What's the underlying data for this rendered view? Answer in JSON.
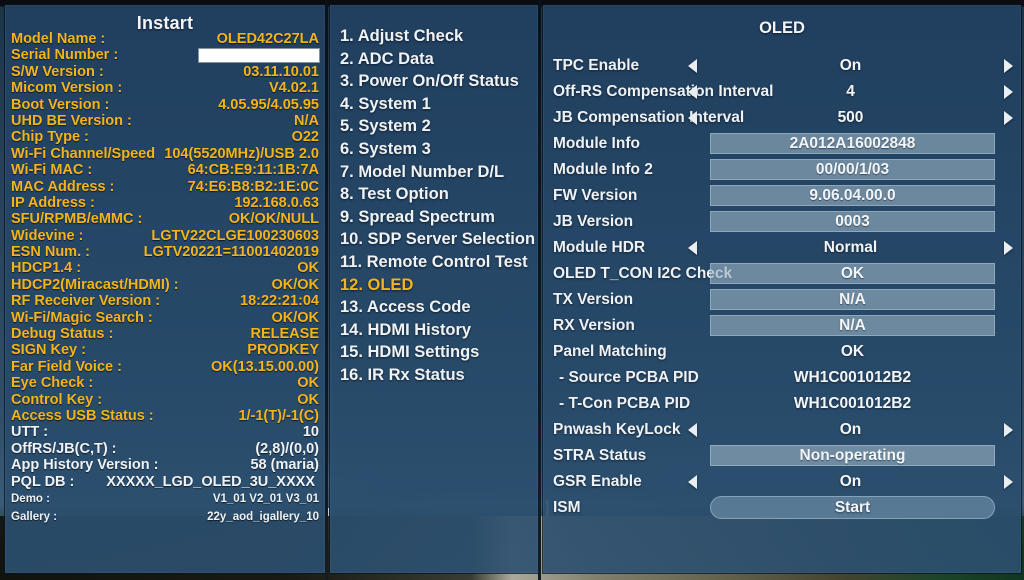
{
  "left_panel": {
    "title": "Instart",
    "rows": [
      {
        "key": "Model Name :",
        "value": "OLED42C27LA",
        "style": "yellow"
      },
      {
        "key": "Serial Number :",
        "value": "",
        "style": "yellow",
        "redacted": true
      },
      {
        "key": "S/W Version :",
        "value": "03.11.10.01",
        "style": "yellow"
      },
      {
        "key": "Micom Version :",
        "value": "V4.02.1",
        "style": "yellow"
      },
      {
        "key": "Boot Version :",
        "value": "4.05.95/4.05.95",
        "style": "yellow"
      },
      {
        "key": "UHD BE Version :",
        "value": "N/A",
        "style": "yellow"
      },
      {
        "key": "Chip Type :",
        "value": "O22",
        "style": "yellow"
      },
      {
        "key": "Wi-Fi Channel/Speed",
        "value": "104(5520MHz)/USB 2.0",
        "style": "yellow"
      },
      {
        "key": "Wi-Fi MAC :",
        "value": "64:CB:E9:11:1B:7A",
        "style": "yellow"
      },
      {
        "key": "MAC Address :",
        "value": "74:E6:B8:B2:1E:0C",
        "style": "yellow"
      },
      {
        "key": "IP Address :",
        "value": "192.168.0.63",
        "style": "yellow"
      },
      {
        "key": "SFU/RPMB/eMMC :",
        "value": "OK/OK/NULL",
        "style": "yellow"
      },
      {
        "key": "Widevine :",
        "value": "LGTV22CLGE100230603",
        "style": "yellow"
      },
      {
        "key": "ESN Num. :",
        "value": "LGTV20221=11001402019",
        "style": "yellow"
      },
      {
        "key": "HDCP1.4 :",
        "value": "OK",
        "style": "yellow"
      },
      {
        "key": "HDCP2(Miracast/HDMI) :",
        "value": "OK/OK",
        "style": "yellow"
      },
      {
        "key": "RF Receiver Version :",
        "value": "18:22:21:04",
        "style": "yellow"
      },
      {
        "key": "Wi-Fi/Magic Search :",
        "value": "OK/OK",
        "style": "yellow"
      },
      {
        "key": "Debug Status :",
        "value": "RELEASE",
        "style": "yellow"
      },
      {
        "key": "SIGN Key :",
        "value": "PRODKEY",
        "style": "yellow"
      },
      {
        "key": "Far Field Voice :",
        "value": "OK(13.15.00.00)",
        "style": "yellow"
      },
      {
        "key": "Eye Check :",
        "value": "OK",
        "style": "yellow"
      },
      {
        "key": "Control Key :",
        "value": "OK",
        "style": "yellow"
      },
      {
        "key": "Access USB Status :",
        "value": "1/-1(T)/-1(C)",
        "style": "yellow"
      },
      {
        "key": "UTT :",
        "value": "10",
        "style": "white"
      },
      {
        "key": "OffRS/JB(C,T) :",
        "value": "(2,8)/(0,0)",
        "style": "white"
      },
      {
        "key": "App History Version :",
        "value": "58 (maria)",
        "style": "white"
      },
      {
        "key": "PQL DB :",
        "value": "XXXXX_LGD_OLED_3U_XXXX",
        "style": "white"
      },
      {
        "key": "Demo :",
        "value": "V1_01 V2_01 V3_01",
        "style": "white",
        "small": true
      },
      {
        "key": "Gallery :",
        "value": "22y_aod_igallery_10",
        "style": "white",
        "small": true
      }
    ]
  },
  "menu_panel": {
    "items": [
      {
        "label": "1. Adjust Check",
        "selected": false
      },
      {
        "label": "2. ADC Data",
        "selected": false
      },
      {
        "label": "3. Power On/Off Status",
        "selected": false
      },
      {
        "label": "4. System 1",
        "selected": false
      },
      {
        "label": "5. System 2",
        "selected": false
      },
      {
        "label": "6. System 3",
        "selected": false
      },
      {
        "label": "7. Model Number D/L",
        "selected": false
      },
      {
        "label": "8. Test Option",
        "selected": false
      },
      {
        "label": "9. Spread Spectrum",
        "selected": false
      },
      {
        "label": "10. SDP Server Selection",
        "selected": false
      },
      {
        "label": "11. Remote Control Test",
        "selected": false
      },
      {
        "label": "12. OLED",
        "selected": true
      },
      {
        "label": "13. Access Code",
        "selected": false
      },
      {
        "label": "14. HDMI History",
        "selected": false
      },
      {
        "label": "15. HDMI Settings",
        "selected": false
      },
      {
        "label": "16. IR Rx Status",
        "selected": false
      }
    ]
  },
  "oled_panel": {
    "title": "OLED",
    "rows": [
      {
        "label": "TPC Enable",
        "value": "On",
        "control": "spinner"
      },
      {
        "label": "Off-RS Compensation Interval",
        "value": "4",
        "control": "spinner"
      },
      {
        "label": "JB Compensation Interval",
        "value": "500",
        "control": "spinner"
      },
      {
        "label": "Module Info",
        "value": "2A012A16002848",
        "control": "boxed"
      },
      {
        "label": "Module Info 2",
        "value": "00/00/1/03",
        "control": "boxed"
      },
      {
        "label": "FW Version",
        "value": "9.06.04.00.0",
        "control": "boxed"
      },
      {
        "label": "JB Version",
        "value": "0003",
        "control": "boxed"
      },
      {
        "label": "Module HDR",
        "value": "Normal",
        "control": "spinner"
      },
      {
        "label": "OLED T_CON I2C Check",
        "value": "OK",
        "control": "boxed"
      },
      {
        "label": "TX Version",
        "value": "N/A",
        "control": "boxed"
      },
      {
        "label": "RX Version",
        "value": "N/A",
        "control": "boxed"
      },
      {
        "label": "Panel Matching",
        "value": "OK",
        "control": "plain"
      },
      {
        "label": " - Source PCBA PID",
        "value": "WH1C001012B2",
        "control": "plain",
        "sub": true
      },
      {
        "label": " - T-Con PCBA PID",
        "value": "WH1C001012B2",
        "control": "plain",
        "sub": true
      },
      {
        "label": "Pnwash KeyLock",
        "value": "On",
        "control": "spinner"
      },
      {
        "label": "STRA Status",
        "value": "Non-operating",
        "control": "boxed"
      },
      {
        "label": "GSR Enable",
        "value": "On",
        "control": "spinner"
      },
      {
        "label": "ISM",
        "value": "Start",
        "control": "button"
      }
    ]
  },
  "colors": {
    "label_yellow": "#f4b41a",
    "label_white": "#f0f3f6",
    "panel_blue": "#26486a",
    "value_box": "#97b2c4"
  }
}
